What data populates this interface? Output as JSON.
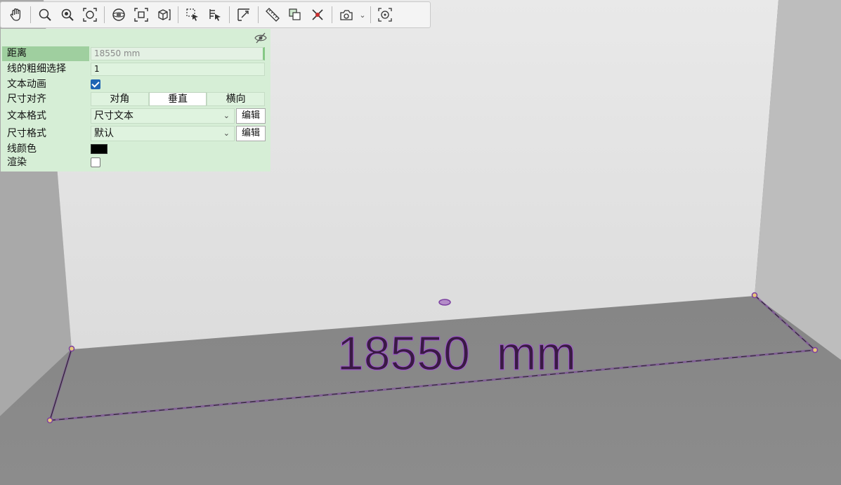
{
  "panel": {
    "distance_label": "距离",
    "distance_value": "18550 mm",
    "line_weight_label": "线的粗细选择",
    "line_weight_value": "1",
    "text_animation_label": "文本动画",
    "text_animation_checked": true,
    "dim_align_label": "尺寸对齐",
    "dim_align_options": [
      "对角",
      "垂直",
      "横向"
    ],
    "dim_align_selected": "垂直",
    "text_format_label": "文本格式",
    "text_format_value": "尺寸文本",
    "dim_format_label": "尺寸格式",
    "dim_format_value": "默认",
    "edit_label": "编辑",
    "line_color_label": "线颜色",
    "line_color": "#000000",
    "render_label": "渲染",
    "render_checked": false
  },
  "viewport": {
    "dimension_text": "18550  mm",
    "dimension_line_color": "#7b3fa0",
    "dimension_text_color": "#3a1a44"
  },
  "toolbar": {
    "buttons": [
      "hand-icon",
      "zoom-icon",
      "zoom-in-icon",
      "zoom-extents-icon",
      "sphere-view-icon",
      "fit-view-icon",
      "box-view-icon",
      "select-region-icon",
      "select-text-icon",
      "dimension-icon",
      "ruler-icon",
      "copy-select-icon",
      "delete-point-icon",
      "camera-icon",
      "center-icon"
    ]
  }
}
